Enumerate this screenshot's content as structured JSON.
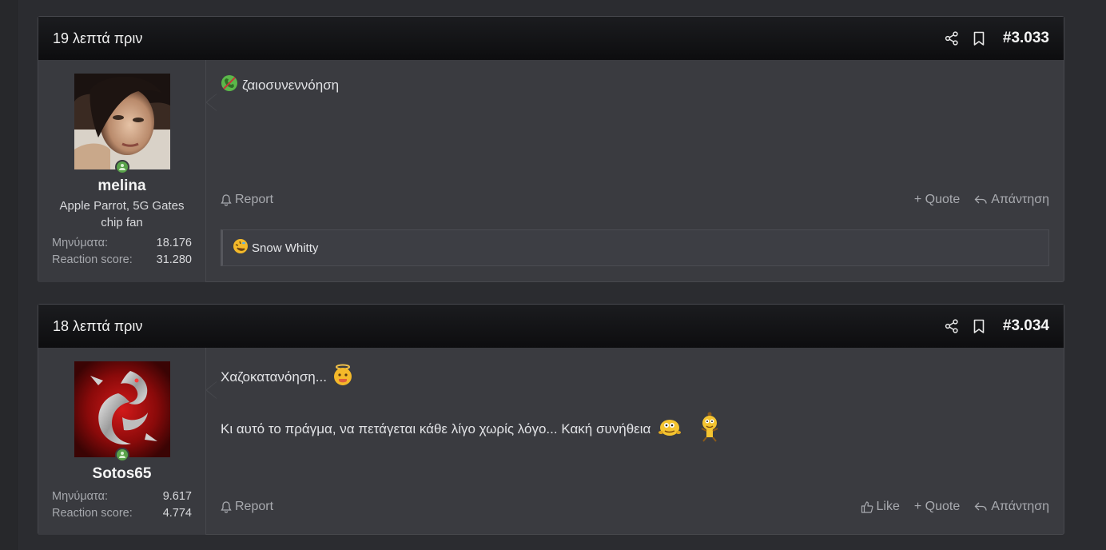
{
  "posts": [
    {
      "time": "19 λεπτά πριν",
      "number": "#3.033",
      "user": {
        "name": "melina",
        "title": "Apple Parrot, 5G Gates chip fan",
        "stats": [
          {
            "label": "Μηνύματα:",
            "value": "18.176"
          },
          {
            "label": "Reaction score:",
            "value": "31.280"
          }
        ]
      },
      "message": "ζαιοσυνεννόηση",
      "actions": {
        "report": "Report",
        "quote": "+ Quote",
        "reply": "Απάντηση"
      },
      "reactions": {
        "names": "Snow Whitty",
        "icon": "rofl-emoji"
      }
    },
    {
      "time": "18 λεπτά πριν",
      "number": "#3.034",
      "user": {
        "name": "Sotos65",
        "stats": [
          {
            "label": "Μηνύματα:",
            "value": "9.617"
          },
          {
            "label": "Reaction score:",
            "value": "4.774"
          }
        ]
      },
      "message_line1": "Χαζοκατανόηση...",
      "message_line2": "Κι αυτό το πράγμα, να πετάγεται κάθε λίγο χωρίς λόγο... Κακή συνήθεια",
      "actions": {
        "report": "Report",
        "like": "Like",
        "quote": "+ Quote",
        "reply": "Απάντηση"
      }
    }
  ],
  "colors": {
    "online": "#59a24a",
    "header_bg": "#111214",
    "post_bg": "#3a3b40"
  }
}
